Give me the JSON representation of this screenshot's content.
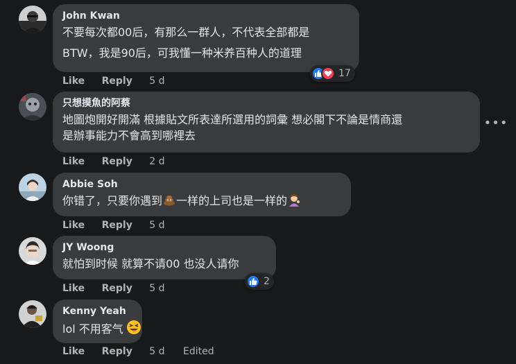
{
  "comments": [
    {
      "author": "John Kwan",
      "lines": [
        "不要每次都00后，有那么一群人，不代表全部都是",
        "BTW，我是90后，可我懂一种米养百种人的道理"
      ],
      "like": "Like",
      "reply": "Reply",
      "time": "5 d",
      "reaction_count": "17",
      "reactions": [
        "like-icon",
        "love-icon"
      ]
    },
    {
      "author": "只想摸魚的阿蔡",
      "lines": [
        "地圖炮開好開滿 根據貼文所表達所選用的詞彙 想必閣下不論是情商還",
        "是辦事能力不會高到哪裡去"
      ],
      "like": "Like",
      "reply": "Reply",
      "time": "2 d",
      "more": "•••"
    },
    {
      "author": "Abbie Soh",
      "text_a": "你错了，只要你遇到",
      "text_b": "一样的上司也是一样的",
      "like": "Like",
      "reply": "Reply",
      "time": "5 d",
      "emojis": [
        "poop-emoji",
        "person-tipping-hand-emoji"
      ]
    },
    {
      "author": "JY Woong",
      "lines": [
        "就怕到时候 就算不请00 也没人请你"
      ],
      "like": "Like",
      "reply": "Reply",
      "time": "5 d",
      "reaction_count": "2",
      "reactions": [
        "like-icon"
      ]
    },
    {
      "author": "Kenny Yeah",
      "text_a": "lol 不用客气",
      "like": "Like",
      "reply": "Reply",
      "time": "5 d",
      "edited": "Edited",
      "emojis": [
        "squinting-tongue-emoji"
      ]
    }
  ],
  "colors": {
    "background": "#18191a",
    "bubble": "#3a3b3c",
    "text": "#e4e6eb",
    "secondary_text": "#b0b3b8",
    "like_blue": "#2078f4",
    "love_red": "#f33e58"
  }
}
